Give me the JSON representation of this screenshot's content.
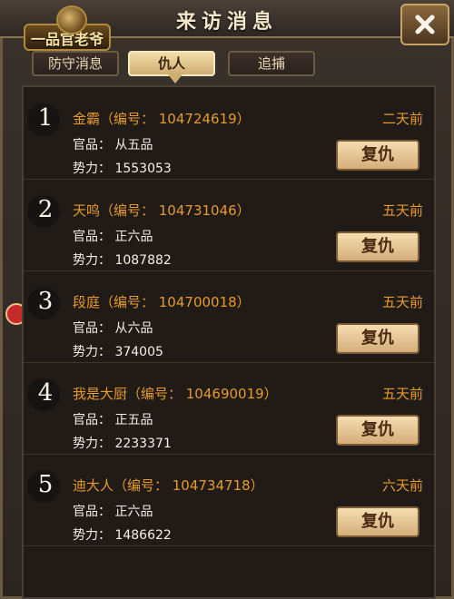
{
  "window": {
    "title": "来访消息",
    "logo": "一品官老爷"
  },
  "tabs": [
    {
      "label": "防守消息",
      "active": false
    },
    {
      "label": "仇人",
      "active": true
    },
    {
      "label": "追捕",
      "active": false
    }
  ],
  "items": [
    {
      "num": "1",
      "name": "金霸（编号： 104724619）",
      "time": "二天前",
      "rank": "官品： 从五品",
      "power": "势力： 1553053",
      "action": "复仇"
    },
    {
      "num": "2",
      "name": "天鸣（编号： 104731046）",
      "time": "五天前",
      "rank": "官品： 正六品",
      "power": "势力： 1087882",
      "action": "复仇"
    },
    {
      "num": "3",
      "name": "段庭（编号： 104700018）",
      "time": "五天前",
      "rank": "官品： 从六品",
      "power": "势力： 374005",
      "action": "复仇"
    },
    {
      "num": "4",
      "name": "我是大厨（编号： 104690019）",
      "time": "五天前",
      "rank": "官品： 正五品",
      "power": "势力： 2233371",
      "action": "复仇"
    },
    {
      "num": "5",
      "name": "迪大人（编号： 104734718）",
      "time": "六天前",
      "rank": "官品： 正六品",
      "power": "势力： 1486622",
      "action": "复仇"
    }
  ],
  "icons": {
    "close": "close-icon",
    "scroll": "scroll-left-icon"
  }
}
